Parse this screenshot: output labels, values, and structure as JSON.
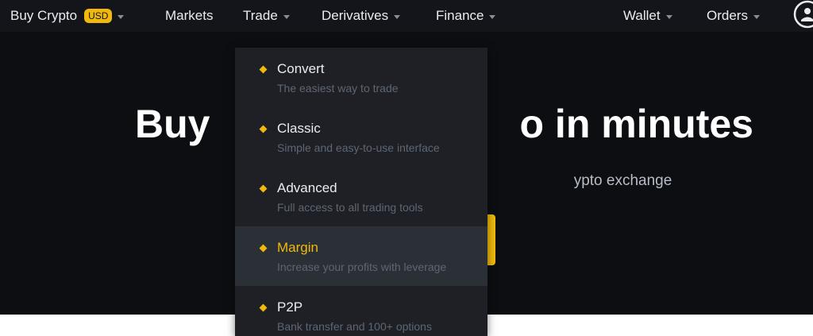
{
  "nav": {
    "buy_crypto": "Buy Crypto",
    "currency_badge": "USD",
    "markets": "Markets",
    "trade": "Trade",
    "derivatives": "Derivatives",
    "finance": "Finance",
    "wallet": "Wallet",
    "orders": "Orders",
    "profile_icon": "user-icon"
  },
  "hero": {
    "title_left": "Buy",
    "title_right": "o in minutes",
    "subtitle_right": "ypto exchange"
  },
  "trade_menu": {
    "items": [
      {
        "title": "Convert",
        "description": "The easiest way to trade",
        "icon": "diamond-icon"
      },
      {
        "title": "Classic",
        "description": "Simple and easy-to-use interface",
        "icon": "diamond-icon"
      },
      {
        "title": "Advanced",
        "description": "Full access to all trading tools",
        "icon": "diamond-icon"
      },
      {
        "title": "Margin",
        "description": "Increase your profits with leverage",
        "icon": "diamond-icon",
        "highlighted": true
      },
      {
        "title": "P2P",
        "description": "Bank transfer and 100+ options",
        "icon": "diamond-icon"
      }
    ]
  },
  "colors": {
    "accent": "#f0b90b",
    "nav_bg": "#13151a",
    "hero_bg": "#0c0e12",
    "menu_bg": "#1e2026",
    "menu_hover_bg": "#2b2f36"
  }
}
